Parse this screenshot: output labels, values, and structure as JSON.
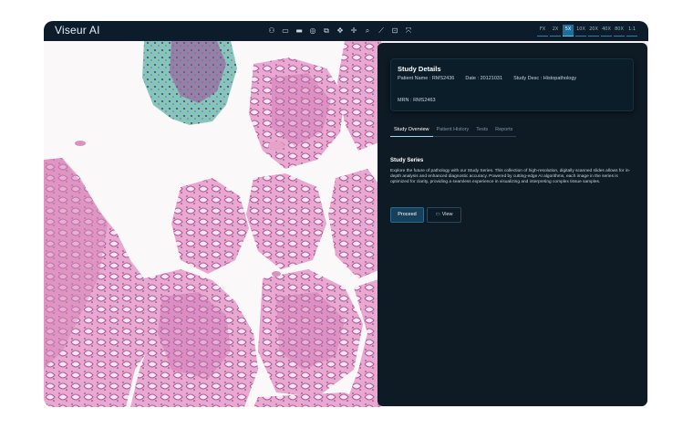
{
  "app": {
    "logo": "Viseur AI"
  },
  "toolbar": {
    "tools": [
      {
        "name": "user-icon",
        "glyph": "⚇"
      },
      {
        "name": "rectangle-icon",
        "glyph": "▭"
      },
      {
        "name": "filled-rect-icon",
        "glyph": "▬"
      },
      {
        "name": "target-icon",
        "glyph": "◎"
      },
      {
        "name": "crop-icon",
        "glyph": "⧉"
      },
      {
        "name": "move-icon",
        "glyph": "✥"
      },
      {
        "name": "crosshair-icon",
        "glyph": "✛"
      },
      {
        "name": "search-icon",
        "glyph": "⌕"
      },
      {
        "name": "ruler-icon",
        "glyph": "⟋"
      },
      {
        "name": "focus-icon",
        "glyph": "⊡"
      },
      {
        "name": "expand-icon",
        "glyph": "⤧"
      }
    ],
    "magnifications": [
      {
        "label": "FX",
        "active": false
      },
      {
        "label": "2X",
        "active": false
      },
      {
        "label": "5X",
        "active": true
      },
      {
        "label": "10X",
        "active": false
      },
      {
        "label": "20X",
        "active": false
      },
      {
        "label": "40X",
        "active": false
      },
      {
        "label": "80X",
        "active": false
      },
      {
        "label": "1:1",
        "active": false
      }
    ]
  },
  "study": {
    "title": "Study Details",
    "patient_name": "Patient Name : RMS2436",
    "date": "Date : 20121031",
    "study_desc": "Study Desc : Histopathology",
    "mrn": "MRN : RMS2463"
  },
  "tabs": [
    "Study Overview",
    "Patient History",
    "Tests",
    "Reports"
  ],
  "active_tab": 0,
  "overview": {
    "title": "Study Series",
    "description": "Explore the future of pathology with our Study Series. This collection of high-resolution, digitally scanned slides allows for in-depth analysis and enhanced diagnostic accuracy. Powered by cutting-edge AI algorithms, each image in the series is optimized for clarity, providing a seamless experience in visualizing and interpreting complex tissue samples.",
    "proceed_label": "Proceed",
    "view_label": "View"
  },
  "colors": {
    "topbar": "#0c1c2b",
    "panel": "#0e1a24",
    "accent": "#1e6e96",
    "tissue_pink": "#e6a3c8",
    "tissue_purple": "#8a3e92",
    "tissue_teal": "#7fc1b6"
  }
}
